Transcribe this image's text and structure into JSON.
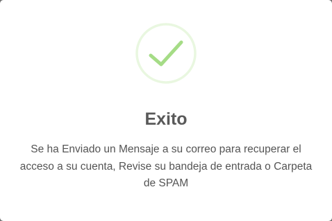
{
  "dialog": {
    "icon": "success-check-icon",
    "accent_color": "#a5dc86",
    "ring_color": "#e9f7e0",
    "title": "Exito",
    "message": "Se ha Enviado un Mensaje a su correo para recuperar el acceso a su cuenta, Revise su bandeja de entrada o Carpeta de SPAM"
  }
}
